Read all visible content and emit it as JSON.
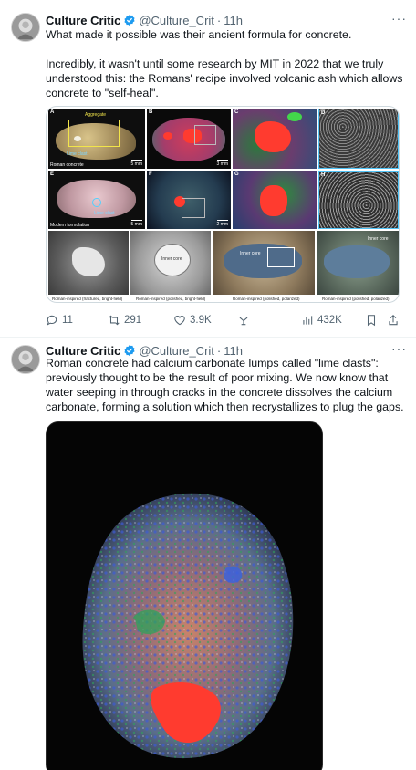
{
  "tweets": [
    {
      "author": {
        "name": "Culture Critic",
        "handle": "@Culture_Crit",
        "time": "11h"
      },
      "text1": "What made it possible was their ancient formula for concrete.",
      "text2": "Incredibly, it wasn't until some research by MIT in 2022 that we truly understood this: the Romans' recipe involved volcanic ash which allows concrete to \"self-heal\".",
      "figure": {
        "panel_labels": [
          "A",
          "B",
          "C",
          "D",
          "E",
          "F",
          "G",
          "H"
        ],
        "label_aggregate": "Aggregate",
        "label_lime_clast": "Lime clast",
        "row_label_roman": "Roman concrete",
        "row_label_modern": "Modern formulation",
        "scale_5mm": "5 mm",
        "scale_3mm": "3 mm",
        "scale_2mm": "2 mm",
        "label_inner_core": "Inner core",
        "captions": [
          "Roman-inspired (fractured, bright-field)",
          "Roman-inspired (polished, bright-field)",
          "Roman-inspired (polished, polarized)",
          "Roman-inspired (polished, polarized)"
        ]
      },
      "stats": {
        "replies": "11",
        "reposts": "291",
        "likes": "3.9K",
        "views": "432K"
      }
    },
    {
      "author": {
        "name": "Culture Critic",
        "handle": "@Culture_Crit",
        "time": "11h"
      },
      "text": "Roman concrete had calcium carbonate lumps called \"lime clasts\": previously thought to be the result of poor mixing. We now know that water seeping in through cracks in the concrete dissolves the calcium carbonate, forming a solution which then recrystallizes to plug the gaps."
    }
  ],
  "colors": {
    "verified": "#1d9bf0",
    "muted": "#536471",
    "accent_red": "#ff3b2f"
  },
  "icons": [
    "verified-badge-icon",
    "more-icon",
    "reply-icon",
    "repost-icon",
    "like-icon",
    "grok-icon",
    "views-icon",
    "bookmark-icon",
    "share-icon"
  ]
}
